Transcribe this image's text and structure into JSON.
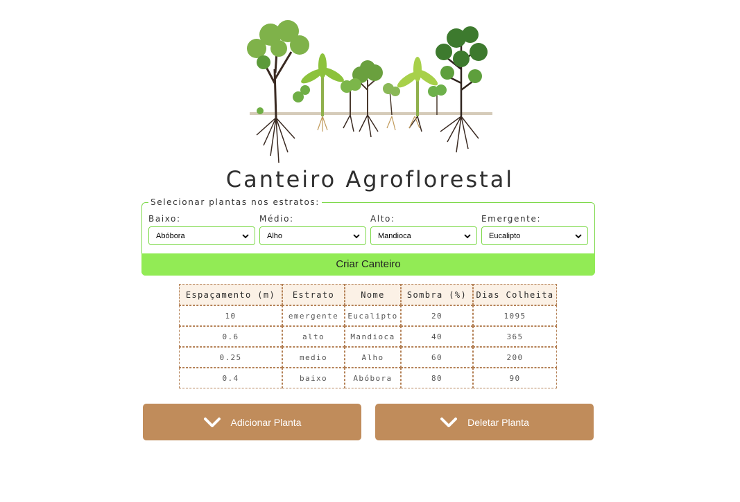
{
  "title": "Canteiro Agroflorestal",
  "illustration": {
    "name": "agroforestry-trees-illustration"
  },
  "strata_form": {
    "legend": "Selecionar plantas nos estratos:",
    "fields": [
      {
        "label": "Baixo:",
        "selected": "Abóbora"
      },
      {
        "label": "Médio:",
        "selected": "Alho"
      },
      {
        "label": "Alto:",
        "selected": "Mandioca"
      },
      {
        "label": "Emergente:",
        "selected": "Eucalipto"
      }
    ],
    "submit_label": "Criar Canteiro"
  },
  "table": {
    "headers": [
      "Espaçamento (m)",
      "Estrato",
      "Nome",
      "Sombra (%)",
      "Dias Colheita"
    ],
    "rows": [
      [
        "10",
        "emergente",
        "Eucalipto",
        "20",
        "1095"
      ],
      [
        "0.6",
        "alto",
        "Mandioca",
        "40",
        "365"
      ],
      [
        "0.25",
        "medio",
        "Alho",
        "60",
        "200"
      ],
      [
        "0.4",
        "baixo",
        "Abóbora",
        "80",
        "90"
      ]
    ]
  },
  "actions": {
    "add_label": "Adicionar Planta",
    "delete_label": "Deletar Planta",
    "icon": "chevron-down-icon"
  },
  "colors": {
    "accent_green": "#92eb55",
    "border_green": "#7dd94a",
    "button_brown": "#c08c5b",
    "table_header_bg": "#fbf1e6",
    "table_border": "#b48156"
  }
}
